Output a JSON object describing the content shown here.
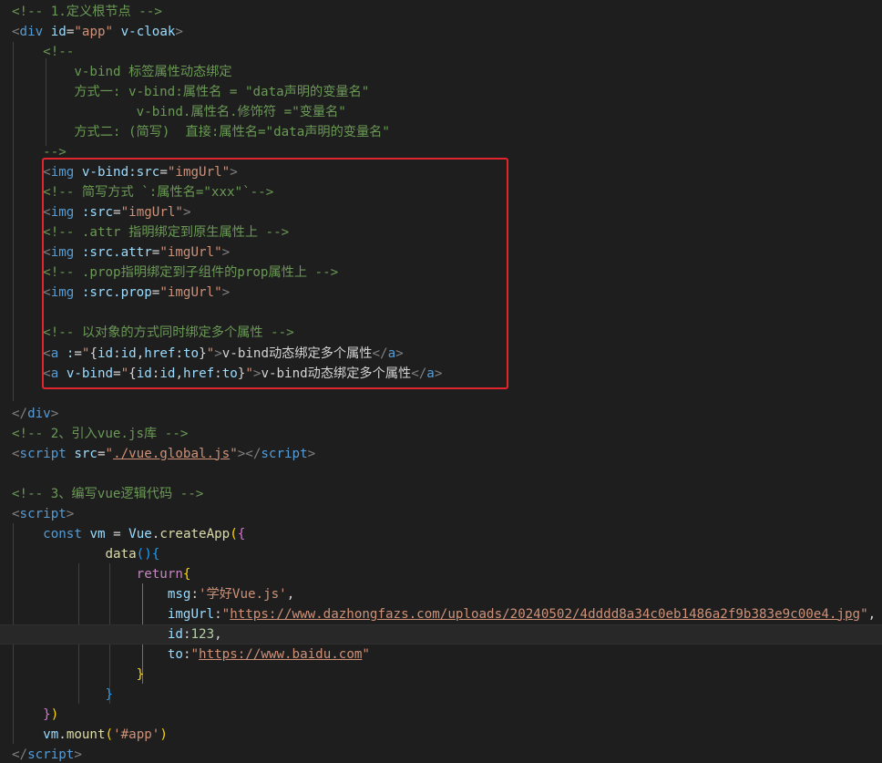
{
  "lines": [
    [
      [
        "cm",
        "<!-- 1.定义根节点 -->"
      ]
    ],
    [
      [
        "pn",
        "<"
      ],
      [
        "tg",
        "div"
      ],
      [
        "tx",
        " "
      ],
      [
        "at",
        "id"
      ],
      [
        "tx",
        "="
      ],
      [
        "st",
        "\"app\""
      ],
      [
        "tx",
        " "
      ],
      [
        "at",
        "v-cloak"
      ],
      [
        "pn",
        ">"
      ]
    ],
    [
      [
        "tx",
        "    "
      ],
      [
        "cm",
        "<!--"
      ]
    ],
    [
      [
        "cm",
        "        v-bind 标签属性动态绑定"
      ]
    ],
    [
      [
        "cm",
        "        方式一: v-bind:属性名 = \"data声明的变量名\""
      ]
    ],
    [
      [
        "cm",
        "                v-bind.属性名.修饰符 =\"变量名\""
      ]
    ],
    [
      [
        "cm",
        "        方式二: (简写)  直接:属性名=\"data声明的变量名\""
      ]
    ],
    [
      [
        "tx",
        "    "
      ],
      [
        "cm",
        "-->"
      ]
    ],
    [
      [
        "tx",
        "    "
      ],
      [
        "pn",
        "<"
      ],
      [
        "tg",
        "img"
      ],
      [
        "tx",
        " "
      ],
      [
        "at",
        "v-bind:src"
      ],
      [
        "tx",
        "="
      ],
      [
        "st",
        "\"imgUrl\""
      ],
      [
        "pn",
        ">"
      ]
    ],
    [
      [
        "tx",
        "    "
      ],
      [
        "cm",
        "<!-- 简写方式 `:属性名=\"xxx\"`-->"
      ]
    ],
    [
      [
        "tx",
        "    "
      ],
      [
        "pn",
        "<"
      ],
      [
        "tg",
        "img"
      ],
      [
        "tx",
        " "
      ],
      [
        "at",
        ":src"
      ],
      [
        "tx",
        "="
      ],
      [
        "st",
        "\"imgUrl\""
      ],
      [
        "pn",
        ">"
      ]
    ],
    [
      [
        "tx",
        "    "
      ],
      [
        "cm",
        "<!-- .attr 指明绑定到原生属性上 -->"
      ]
    ],
    [
      [
        "tx",
        "    "
      ],
      [
        "pn",
        "<"
      ],
      [
        "tg",
        "img"
      ],
      [
        "tx",
        " "
      ],
      [
        "at",
        ":src.attr"
      ],
      [
        "tx",
        "="
      ],
      [
        "st",
        "\"imgUrl\""
      ],
      [
        "pn",
        ">"
      ]
    ],
    [
      [
        "tx",
        "    "
      ],
      [
        "cm",
        "<!-- .prop指明绑定到子组件的prop属性上 -->"
      ]
    ],
    [
      [
        "tx",
        "    "
      ],
      [
        "pn",
        "<"
      ],
      [
        "tg",
        "img"
      ],
      [
        "tx",
        " "
      ],
      [
        "at",
        ":src.prop"
      ],
      [
        "tx",
        "="
      ],
      [
        "st",
        "\"imgUrl\""
      ],
      [
        "pn",
        ">"
      ]
    ],
    [
      [
        "tx",
        ""
      ]
    ],
    [
      [
        "tx",
        "    "
      ],
      [
        "cm",
        "<!-- 以对象的方式同时绑定多个属性 -->"
      ]
    ],
    [
      [
        "tx",
        "    "
      ],
      [
        "pn",
        "<"
      ],
      [
        "tg",
        "a"
      ],
      [
        "tx",
        " "
      ],
      [
        "at",
        ":"
      ],
      [
        "tx",
        "="
      ],
      [
        "st",
        "\""
      ],
      [
        "tx",
        "{"
      ],
      [
        "vr",
        "id"
      ],
      [
        "tx",
        ":"
      ],
      [
        "vr",
        "id"
      ],
      [
        "tx",
        ","
      ],
      [
        "vr",
        "href"
      ],
      [
        "tx",
        ":"
      ],
      [
        "vr",
        "to"
      ],
      [
        "tx",
        "}"
      ],
      [
        "st",
        "\""
      ],
      [
        "pn",
        ">"
      ],
      [
        "tx",
        "v-bind动态绑定多个属性"
      ],
      [
        "pn",
        "</"
      ],
      [
        "tg",
        "a"
      ],
      [
        "pn",
        ">"
      ]
    ],
    [
      [
        "tx",
        "    "
      ],
      [
        "pn",
        "<"
      ],
      [
        "tg",
        "a"
      ],
      [
        "tx",
        " "
      ],
      [
        "at",
        "v-bind"
      ],
      [
        "tx",
        "="
      ],
      [
        "st",
        "\""
      ],
      [
        "tx",
        "{"
      ],
      [
        "vr",
        "id"
      ],
      [
        "tx",
        ":"
      ],
      [
        "vr",
        "id"
      ],
      [
        "tx",
        ","
      ],
      [
        "vr",
        "href"
      ],
      [
        "tx",
        ":"
      ],
      [
        "vr",
        "to"
      ],
      [
        "tx",
        "}"
      ],
      [
        "st",
        "\""
      ],
      [
        "pn",
        ">"
      ],
      [
        "tx",
        "v-bind动态绑定多个属性"
      ],
      [
        "pn",
        "</"
      ],
      [
        "tg",
        "a"
      ],
      [
        "pn",
        ">"
      ]
    ],
    [
      [
        "tx",
        ""
      ]
    ],
    [
      [
        "pn",
        "</"
      ],
      [
        "tg",
        "div"
      ],
      [
        "pn",
        ">"
      ]
    ],
    [
      [
        "cm",
        "<!-- 2、引入vue.js库 -->"
      ]
    ],
    [
      [
        "pn",
        "<"
      ],
      [
        "tg",
        "script"
      ],
      [
        "tx",
        " "
      ],
      [
        "at",
        "src"
      ],
      [
        "tx",
        "="
      ],
      [
        "st",
        "\""
      ],
      [
        "lk",
        "./vue.global.js"
      ],
      [
        "st",
        "\""
      ],
      [
        "pn",
        "></"
      ],
      [
        "tg",
        "script"
      ],
      [
        "pn",
        ">"
      ]
    ],
    [
      [
        "tx",
        ""
      ]
    ],
    [
      [
        "cm",
        "<!-- 3、编写vue逻辑代码 -->"
      ]
    ],
    [
      [
        "pn",
        "<"
      ],
      [
        "tg",
        "script"
      ],
      [
        "pn",
        ">"
      ]
    ],
    [
      [
        "tx",
        "    "
      ],
      [
        "kw",
        "const"
      ],
      [
        "tx",
        " "
      ],
      [
        "vr",
        "vm"
      ],
      [
        "tx",
        " = "
      ],
      [
        "vr",
        "Vue"
      ],
      [
        "tx",
        "."
      ],
      [
        "fn",
        "createApp"
      ],
      [
        "b1",
        "("
      ],
      [
        "b2",
        "{"
      ]
    ],
    [
      [
        "tx",
        "            "
      ],
      [
        "fn",
        "data"
      ],
      [
        "b3",
        "()"
      ],
      [
        "b3",
        "{"
      ]
    ],
    [
      [
        "tx",
        "                "
      ],
      [
        "ct",
        "return"
      ],
      [
        "b1",
        "{"
      ]
    ],
    [
      [
        "tx",
        "                    "
      ],
      [
        "vr",
        "msg"
      ],
      [
        "tx",
        ":"
      ],
      [
        "st",
        "'学好Vue.js'"
      ],
      [
        "tx",
        ","
      ]
    ],
    [
      [
        "tx",
        "                    "
      ],
      [
        "vr",
        "imgUrl"
      ],
      [
        "tx",
        ":"
      ],
      [
        "st",
        "\""
      ],
      [
        "lk",
        "https://www.dazhongfazs.com/uploads/20240502/4dddd8a34c0eb1486a2f9b383e9c00e4.jpg"
      ],
      [
        "st",
        "\""
      ],
      [
        "tx",
        ","
      ]
    ],
    [
      [
        "tx",
        "                    "
      ],
      [
        "vr",
        "id"
      ],
      [
        "tx",
        ":"
      ],
      [
        "nm",
        "123"
      ],
      [
        "tx",
        ","
      ]
    ],
    [
      [
        "tx",
        "                    "
      ],
      [
        "vr",
        "to"
      ],
      [
        "tx",
        ":"
      ],
      [
        "st",
        "\""
      ],
      [
        "lk",
        "https://www.baidu.com"
      ],
      [
        "st",
        "\""
      ]
    ],
    [
      [
        "tx",
        "                "
      ],
      [
        "b1",
        "}"
      ]
    ],
    [
      [
        "tx",
        "            "
      ],
      [
        "b3",
        "}"
      ]
    ],
    [
      [
        "tx",
        "    "
      ],
      [
        "b2",
        "}"
      ],
      [
        "b1",
        ")"
      ]
    ],
    [
      [
        "tx",
        "    "
      ],
      [
        "vr",
        "vm"
      ],
      [
        "tx",
        "."
      ],
      [
        "fn",
        "mount"
      ],
      [
        "b1",
        "("
      ],
      [
        "st",
        "'#app'"
      ],
      [
        "b1",
        ")"
      ]
    ],
    [
      [
        "pn",
        "</"
      ],
      [
        "tg",
        "script"
      ],
      [
        "pn",
        ">"
      ]
    ]
  ]
}
